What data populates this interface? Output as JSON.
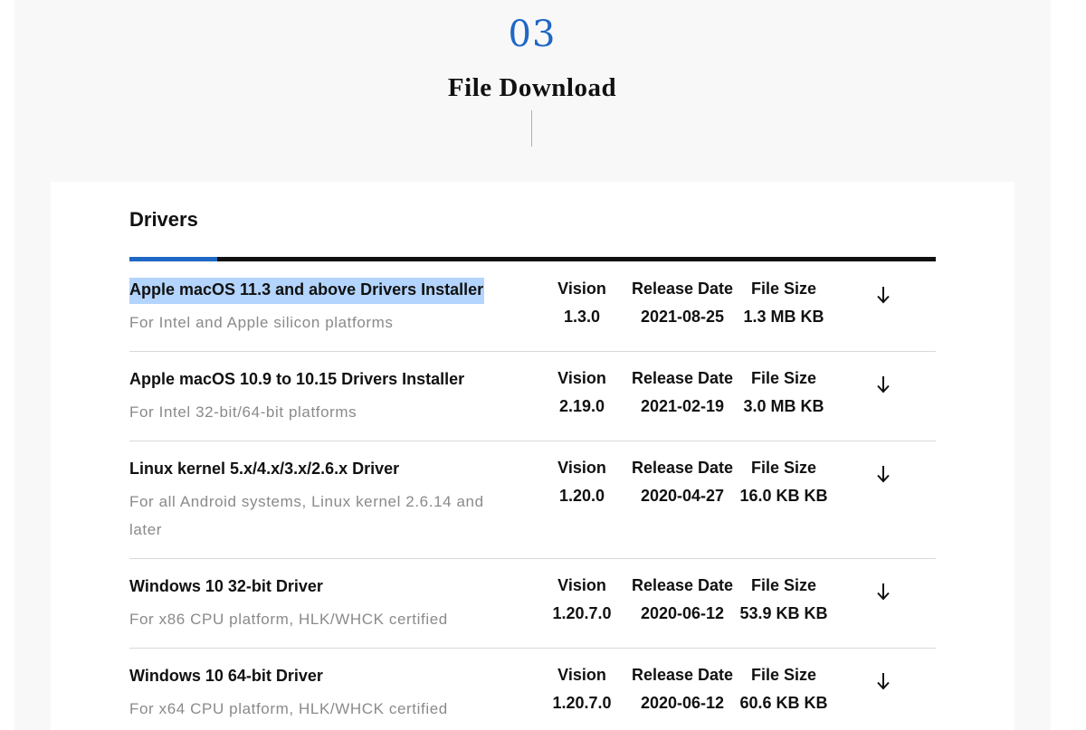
{
  "header": {
    "section_number": "03",
    "section_title": "File Download"
  },
  "drivers": {
    "title": "Drivers",
    "download_icon": "arrow-down-icon",
    "colors": {
      "accent": "#1f67c4",
      "selection": "#b3d4fc",
      "tab_bar": "#111111"
    },
    "items": [
      {
        "name": "Apple macOS 11.3 and above Drivers Installer",
        "description": "For Intel and Apple silicon platforms",
        "version_label": "Vision",
        "version": "1.3.0",
        "date_label": "Release Date",
        "date": "2021-08-25",
        "size_label": "File Size",
        "size": "1.3 MB KB",
        "selected": true
      },
      {
        "name": "Apple macOS 10.9 to 10.15 Drivers Installer",
        "description": "For Intel 32-bit/64-bit platforms",
        "version_label": "Vision",
        "version": "2.19.0",
        "date_label": "Release Date",
        "date": "2021-02-19",
        "size_label": "File Size",
        "size": "3.0 MB KB",
        "selected": false
      },
      {
        "name": "Linux kernel 5.x/4.x/3.x/2.6.x Driver",
        "description": "For all Android systems, Linux kernel 2.6.14 and later",
        "version_label": "Vision",
        "version": "1.20.0",
        "date_label": "Release Date",
        "date": "2020-04-27",
        "size_label": "File Size",
        "size": "16.0 KB KB",
        "selected": false
      },
      {
        "name": "Windows 10 32-bit Driver",
        "description": "For x86 CPU platform, HLK/WHCK certified",
        "version_label": "Vision",
        "version": "1.20.7.0",
        "date_label": "Release Date",
        "date": "2020-06-12",
        "size_label": "File Size",
        "size": "53.9 KB KB",
        "selected": false
      },
      {
        "name": "Windows 10 64-bit Driver",
        "description": "For x64 CPU platform, HLK/WHCK certified",
        "version_label": "Vision",
        "version": "1.20.7.0",
        "date_label": "Release Date",
        "date": "2020-06-12",
        "size_label": "File Size",
        "size": "60.6 KB KB",
        "selected": false
      }
    ]
  }
}
